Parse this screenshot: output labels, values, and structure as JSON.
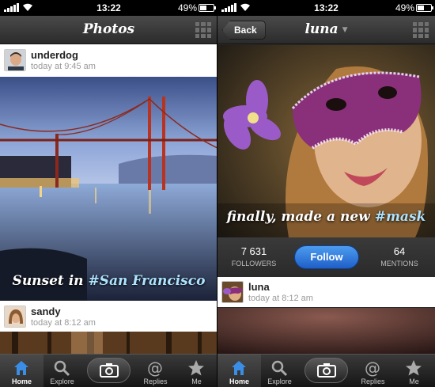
{
  "status_bar": {
    "time": "13:22",
    "battery": "49%"
  },
  "left": {
    "title": "Photos",
    "posts": [
      {
        "username": "underdog",
        "time": "today at 9:45 am",
        "caption_text": "Sunset in ",
        "caption_tag": "#San Francisco"
      },
      {
        "username": "sandy",
        "time": "today at 8:12 am"
      }
    ]
  },
  "right": {
    "back_label": "Back",
    "title": "luna",
    "caption_text": "finally, made a new ",
    "caption_tag": "#mask",
    "followers_count": "7 631",
    "followers_label": "FOLLOWERS",
    "follow_label": "Follow",
    "mentions_count": "64",
    "mentions_label": "MENTIONS",
    "post": {
      "username": "luna",
      "time": "today at 8:12 am"
    }
  },
  "tabs": [
    {
      "label": "Home",
      "icon": "home-icon"
    },
    {
      "label": "Explore",
      "icon": "search-icon"
    },
    {
      "label": "",
      "icon": "camera-icon"
    },
    {
      "label": "Replies",
      "icon": "at-sign-icon"
    },
    {
      "label": "Me",
      "icon": "star-icon"
    }
  ],
  "colors": {
    "accent_blue": "#3a8ee6",
    "hashtag": "#aee4ff",
    "active_tab": "#3a8ee6"
  }
}
